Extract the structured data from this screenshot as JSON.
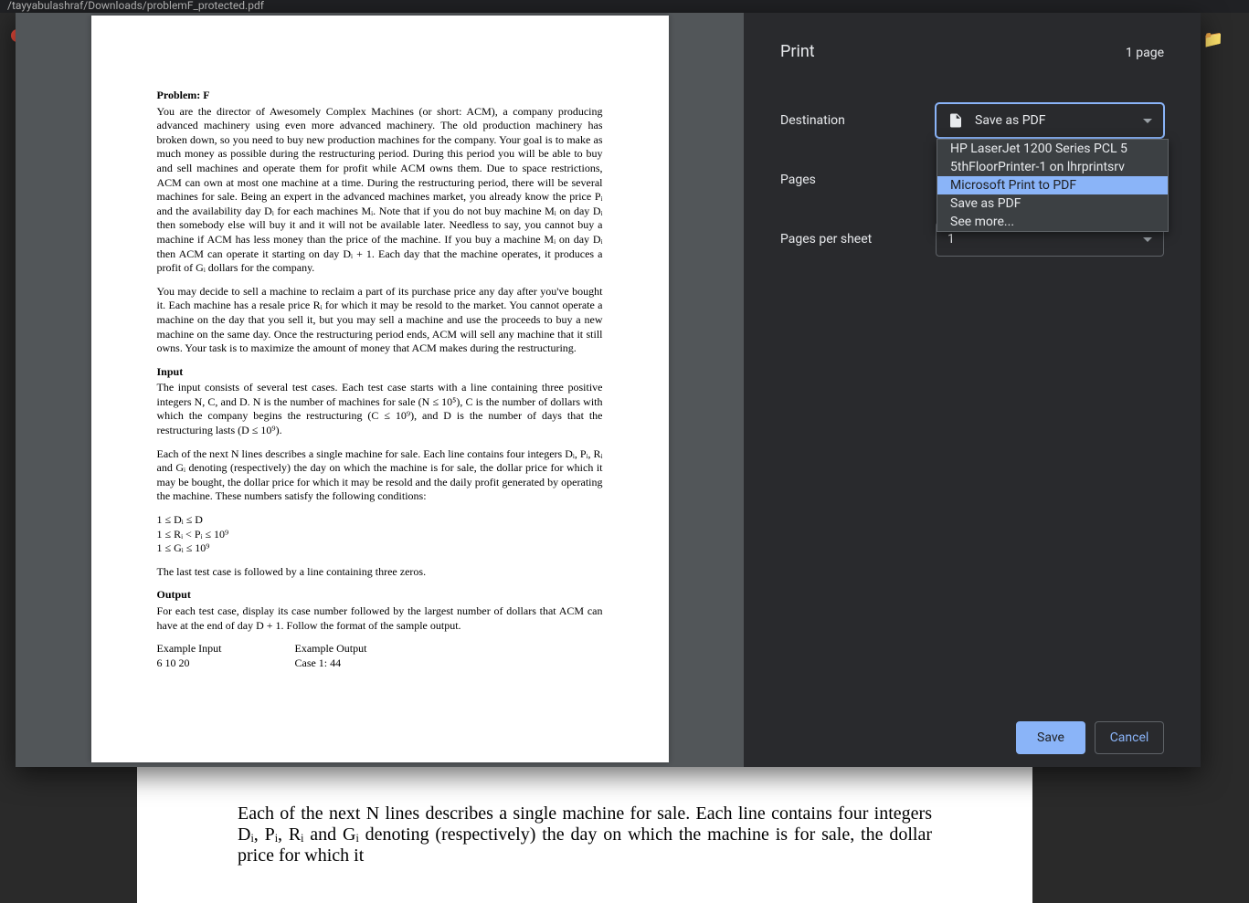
{
  "browser": {
    "address_fragment": "/tayyabulashraf/Downloads/problemF_protected.pdf"
  },
  "underlying_text": "Each of the next N lines describes a single machine for sale. Each line contains four integers Dᵢ, Pᵢ, Rᵢ and Gᵢ denoting (respectively) the day on which the machine is for sale, the dollar price for which it",
  "pdf": {
    "title": "Problem: F",
    "p1": "You are the director of Awesomely Complex Machines (or short: ACM), a company producing advanced machinery using even more advanced machinery. The old production machinery has broken down, so you need to buy new production machines for the company. Your goal is to make as much money as possible during the restructuring period. During this period you will be able to buy and sell machines and operate them for profit while ACM owns them. Due to space restrictions, ACM can own at most one machine at a time. During the restructuring period, there will be several machines for sale. Being an expert in the advanced machines market, you already know the price Pᵢ and the availability day Dᵢ for each machines Mᵢ. Note that if you do not buy machine Mᵢ on day Dᵢ then somebody else will buy it and it will not be available later. Needless to say, you cannot buy a machine if ACM has less money than the price of the machine. If you buy a machine Mᵢ on day Dᵢ then ACM can operate it starting on day Dᵢ + 1. Each day that the machine operates, it produces a profit of Gᵢ dollars for the company.",
    "p2": "You may decide to sell a machine to reclaim a part of its purchase price any day after you've bought it. Each machine has a resale price Rᵢ for which it may be resold to the market. You cannot operate a machine on the day that you sell it, but you may sell a machine and use the proceeds to buy a new machine on the same day. Once the restructuring period ends, ACM will sell any machine that it still owns. Your task is to maximize the amount of money that ACM makes during the restructuring.",
    "input_h": "Input",
    "input_1": "The input consists of several test cases. Each test case starts with a line containing three positive integers N, C, and D. N is the number of machines for sale (N ≤ 10⁵), C is the number of dollars with which the company begins the restructuring (C ≤ 10⁹), and D is the number of days that the restructuring lasts (D ≤ 10⁹).",
    "input_2": "Each of the next N lines describes a single machine for sale. Each line contains four integers Dᵢ, Pᵢ, Rᵢ and Gᵢ denoting (respectively) the day on which the machine is for sale, the dollar price for which it may be bought, the dollar price for which it may be resold and the daily profit generated by operating the machine. These numbers satisfy the following conditions:",
    "cond1": "1 ≤ Dᵢ ≤ D",
    "cond2": "1 ≤ Rᵢ < Pᵢ ≤ 10⁹",
    "cond3": "1 ≤ Gᵢ ≤ 10⁹",
    "input_3": "The last test case is followed by a line containing three zeros.",
    "output_h": "Output",
    "output_1": "For each test case, display its case number followed by the largest number of dollars that ACM can have at the end of day D + 1. Follow the format of the sample output.",
    "ex_in_h": "Example Input",
    "ex_in_v": "6 10 20",
    "ex_out_h": "Example Output",
    "ex_out_v": "Case 1: 44"
  },
  "print": {
    "title": "Print",
    "page_count": "1 page",
    "settings": {
      "destination_label": "Destination",
      "destination_value": "Save as PDF",
      "pages_label": "Pages",
      "pages_per_sheet_label": "Pages per sheet",
      "pages_per_sheet_value": "1"
    },
    "destination_options": [
      {
        "label": "HP LaserJet 1200 Series PCL 5",
        "highlight": false
      },
      {
        "label": "5thFloorPrinter-1 on lhrprintsrv",
        "highlight": false
      },
      {
        "label": "Microsoft Print to PDF",
        "highlight": true
      },
      {
        "label": "Save as PDF",
        "highlight": false
      },
      {
        "label": "See more...",
        "highlight": false
      }
    ],
    "actions": {
      "save": "Save",
      "cancel": "Cancel"
    }
  }
}
